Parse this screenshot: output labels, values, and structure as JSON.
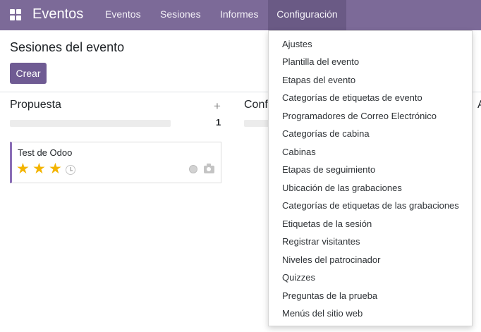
{
  "navbar": {
    "app_title": "Eventos",
    "menu": [
      "Eventos",
      "Sesiones",
      "Informes",
      "Configuración"
    ]
  },
  "page": {
    "title": "Sesiones del evento",
    "create_label": "Crear"
  },
  "kanban": {
    "columns": [
      {
        "title": "Propuesta",
        "count": "1"
      },
      {
        "title": "Conf"
      },
      {
        "title": "A"
      }
    ],
    "cards": [
      {
        "title": "Test de Odoo",
        "stars": 3
      }
    ]
  },
  "dropdown": {
    "items": [
      "Ajustes",
      "Plantilla del evento",
      "Etapas del evento",
      "Categorías de etiquetas de evento",
      "Programadores de Correo Electrónico",
      "Categorías de cabina",
      "Cabinas",
      "Etapas de seguimiento",
      "Ubicación de las grabaciones",
      "Categorías de etiquetas de las grabaciones",
      "Etiquetas de la sesión",
      "Registrar visitantes",
      "Niveles del patrocinador",
      "Quizzes",
      "Preguntas de la prueba",
      "Menús del sitio web"
    ]
  },
  "colors": {
    "navbar": "#7c6a98",
    "primary": "#6f5b93",
    "star": "#f3b400"
  }
}
